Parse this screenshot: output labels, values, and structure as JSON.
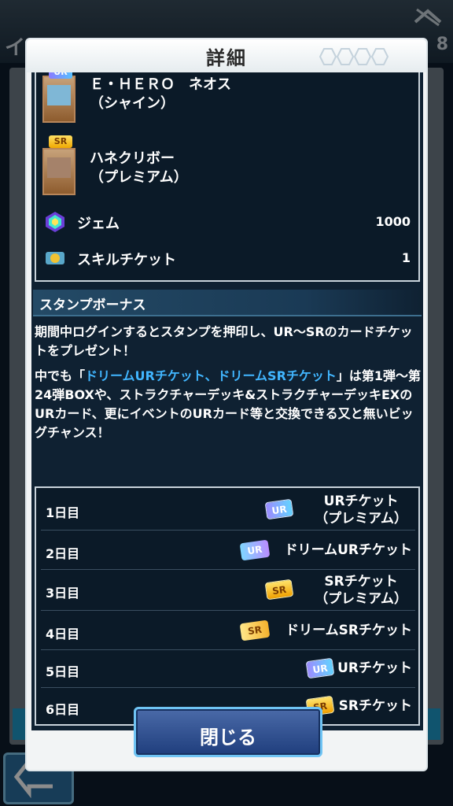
{
  "background": {
    "title": "イン",
    "count": "8"
  },
  "dialog": {
    "title": "詳細",
    "rewards": [
      {
        "rarity": "UR",
        "name": "Ｅ・ＨＥＲＯ　ネオス\n（シャイン）"
      },
      {
        "rarity": "SR",
        "name": "ハネクリボー\n（プレミアム）"
      }
    ],
    "items": [
      {
        "icon": "gem-icon",
        "label": "ジェム",
        "value": "1000"
      },
      {
        "icon": "skill-ticket-icon",
        "label": "スキルチケット",
        "value": "1"
      }
    ],
    "section_title": "スタンプボーナス",
    "desc1": "期間中ログインするとスタンプを押印し、UR～SRのカードチケットをプレゼント！",
    "desc2_prefix": "中でも「",
    "desc2_highlight": "ドリームURチケット、ドリームSRチケット",
    "desc2_suffix": "」は第1弾～第24弾BOXや、ストラクチャーデッキ&ストラクチャーデッキEXのURカード、更にイベントのURカード等と交換できる又と無いビッグチャンス！",
    "stamps": [
      {
        "day": "1日目",
        "ticket": "URチケット\n（プレミアム）",
        "icon": "UR",
        "kind": "ur"
      },
      {
        "day": "2日目",
        "ticket": "ドリームURチケット",
        "icon": "UR",
        "kind": "dream-ur"
      },
      {
        "day": "3日目",
        "ticket": "SRチケット\n（プレミアム）",
        "icon": "SR",
        "kind": "sr"
      },
      {
        "day": "4日目",
        "ticket": "ドリームSRチケット",
        "icon": "SR",
        "kind": "dream-sr"
      },
      {
        "day": "5日目",
        "ticket": "URチケット",
        "icon": "UR",
        "kind": "ur"
      },
      {
        "day": "6日目",
        "ticket": "SRチケット",
        "icon": "SR",
        "kind": "sr"
      }
    ],
    "close_label": "閉じる"
  }
}
